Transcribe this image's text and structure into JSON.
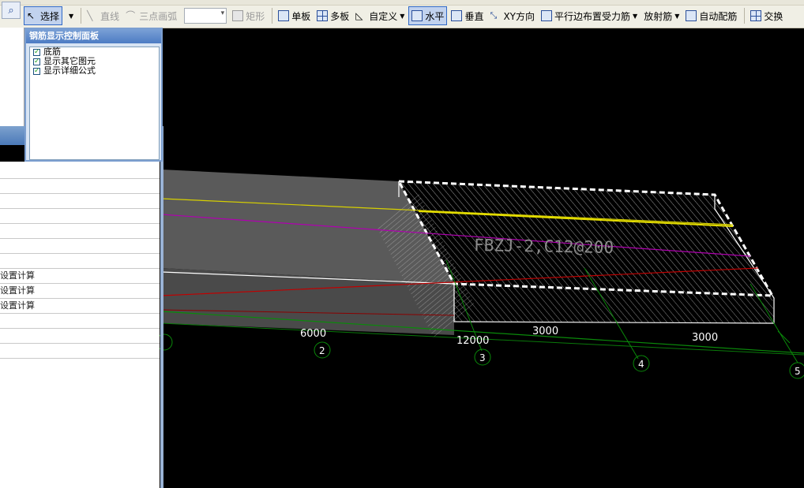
{
  "toolbar": {
    "select_label": "选择",
    "line_label": "直线",
    "arc_label": "三点画弧",
    "rect_label": "矩形",
    "single_board_label": "单板",
    "multi_board_label": "多板",
    "custom_label": "自定义",
    "horizontal_label": "水平",
    "vertical_label": "垂直",
    "xy_dir_label": "XY方向",
    "parallel_edge_label": "平行边布置受力筋",
    "radial_label": "放射筋",
    "auto_rebar_label": "自动配筋",
    "swap_label": "交换"
  },
  "control_panel": {
    "title": "钢筋显示控制面板",
    "items": [
      {
        "label": "底筋",
        "checked": true
      },
      {
        "label": "显示其它图元",
        "checked": true
      },
      {
        "label": "显示详细公式",
        "checked": true
      }
    ]
  },
  "left_list": {
    "rows": [
      "",
      "",
      "",
      "",
      "",
      "",
      "",
      "设置计算",
      "设置计算",
      "设置计算",
      "",
      "",
      ""
    ]
  },
  "viewport": {
    "slab_label": "FBZJ-2,C12@200",
    "dimensions": [
      "6000",
      "12000",
      "3000",
      "3000"
    ],
    "axes": [
      "2",
      "3",
      "4",
      "5"
    ]
  }
}
